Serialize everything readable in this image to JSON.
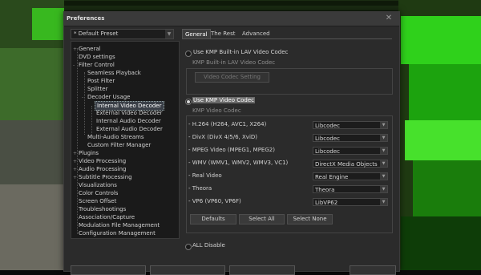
{
  "window": {
    "title": "Preferences",
    "close_icon": "close-icon"
  },
  "preset": {
    "value": "* Default Preset"
  },
  "tree": [
    {
      "label": "General",
      "expander": "+"
    },
    {
      "label": "DVD settings",
      "expander": ""
    },
    {
      "label": "Filter Control",
      "expander": "-"
    },
    {
      "label": "Seamless Playback",
      "expander": ""
    },
    {
      "label": "Post Filter",
      "expander": ""
    },
    {
      "label": "Splitter",
      "expander": ""
    },
    {
      "label": "Decoder Usage",
      "expander": "-"
    },
    {
      "label": "Internal Video Decoder",
      "expander": "",
      "selected": true
    },
    {
      "label": "External Video Decoder",
      "expander": ""
    },
    {
      "label": "Internal Audio Decoder",
      "expander": ""
    },
    {
      "label": "External Audio Decoder",
      "expander": ""
    },
    {
      "label": "Multi-Audio Streams",
      "expander": ""
    },
    {
      "label": "Custom Filter Manager",
      "expander": ""
    },
    {
      "label": "Plugins",
      "expander": "+"
    },
    {
      "label": "Video Processing",
      "expander": "+"
    },
    {
      "label": "Audio Processing",
      "expander": "+"
    },
    {
      "label": "Subtitle Processing",
      "expander": "+"
    },
    {
      "label": "Visualizations",
      "expander": ""
    },
    {
      "label": "Color Controls",
      "expander": ""
    },
    {
      "label": "Screen Offset",
      "expander": ""
    },
    {
      "label": "Troubleshootings",
      "expander": ""
    },
    {
      "label": "Association/Capture",
      "expander": ""
    },
    {
      "label": "Modulation File Management",
      "expander": ""
    },
    {
      "label": "Configuration Management",
      "expander": ""
    }
  ],
  "tabs": [
    {
      "label": "General",
      "active": true
    },
    {
      "label": "The Rest",
      "active": false
    },
    {
      "label": "Advanced",
      "active": false
    }
  ],
  "lav": {
    "radio_label": "Use KMP Built-in LAV Video Codec",
    "group_label": "KMP Built-in LAV Video Codec",
    "setting_button": "Video Codec Setting"
  },
  "kmp": {
    "radio_label": "Use KMP Video Codec",
    "group_label": "KMP Video Codec"
  },
  "codecs": [
    {
      "label": "- H.264 (H264, AVC1, X264)",
      "value": "Libcodec"
    },
    {
      "label": "- DivX (DivX 4/5/6, XviD)",
      "value": "Libcodec"
    },
    {
      "label": "- MPEG Video (MPEG1, MPEG2)",
      "value": "Libcodec"
    },
    {
      "label": "- WMV (WMV1, WMV2, WMV3, VC1)",
      "value": "DirectX Media Objects"
    },
    {
      "label": "- Real Video",
      "value": "Real Engine"
    },
    {
      "label": "- Theora",
      "value": "Theora"
    },
    {
      "label": "- VP6 (VP60, VP6F)",
      "value": "LibVP62"
    }
  ],
  "buttons": {
    "defaults": "Defaults",
    "select_all": "Select All",
    "select_none": "Select None"
  },
  "all_disable": {
    "label": "ALL Disable"
  }
}
